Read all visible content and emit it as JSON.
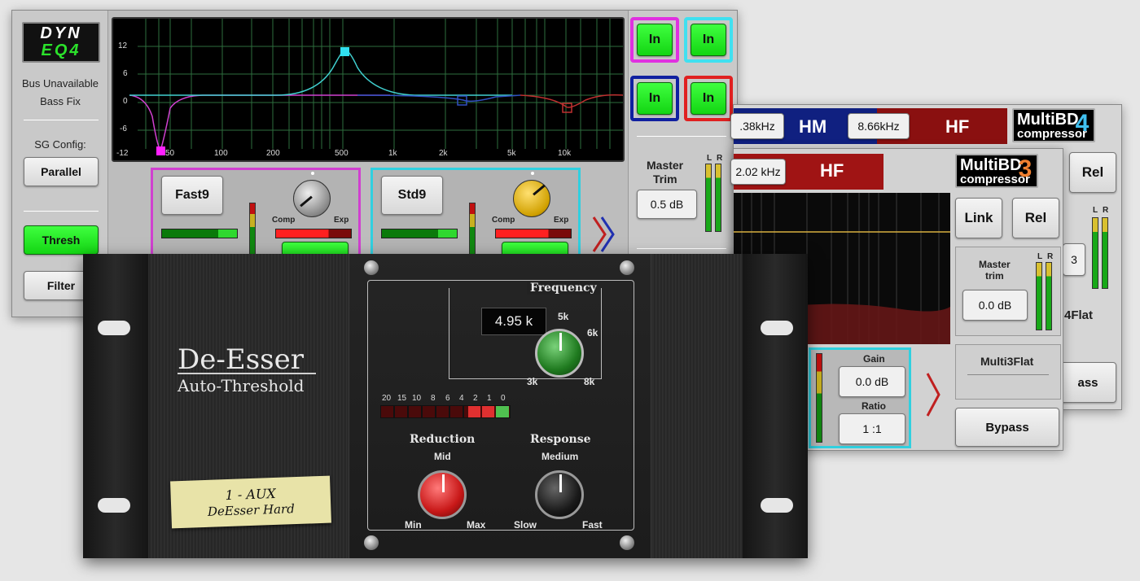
{
  "dyn_eq4": {
    "logo_top": "DYN",
    "logo_bottom": "EQ4",
    "status_line1": "Bus Unavailable",
    "status_line2": "Bass Fix",
    "sg_config_label": "SG Config:",
    "parallel_button": "Parallel",
    "thresh_button": "Thresh",
    "filter_button": "Filter",
    "graph": {
      "y_ticks": [
        "12",
        "6",
        "0",
        "-6",
        "-12"
      ],
      "x_ticks": [
        "50",
        "100",
        "200",
        "500",
        "1k",
        "2k",
        "5k",
        "10k"
      ]
    },
    "band1": {
      "preset": "Fast9",
      "comp_label": "Comp",
      "exp_label": "Exp"
    },
    "band2": {
      "preset": "Std9",
      "comp_label": "Comp",
      "exp_label": "Exp"
    },
    "in_buttons": [
      "In",
      "In",
      "In",
      "In"
    ],
    "master_trim_label_1": "Master",
    "master_trim_label_2": "Trim",
    "master_trim_value": "0.5 dB",
    "meter_l": "L",
    "meter_r": "R"
  },
  "multibd4": {
    "freq1": ".38kHz",
    "band_hm": "HM",
    "freq2": "8.66kHz",
    "band_hf": "HF",
    "logo_line1": "MultiBD",
    "logo_line2": "compressor",
    "logo_num": "4",
    "rel_button": "Rel",
    "value_partial": "3",
    "preset_partial": "4Flat",
    "bypass_partial": "ass",
    "meter_l": "L",
    "meter_r": "R"
  },
  "multibd3": {
    "freq": "2.02 kHz",
    "band_hf": "HF",
    "logo_line1": "MultiBD",
    "logo_line2": "compressor",
    "logo_num": "3",
    "link_button": "Link",
    "rel_button": "Rel",
    "master_trim_label_1": "Master",
    "master_trim_label_2": "trim",
    "master_trim_value": "0.0 dB",
    "gain_label": "Gain",
    "gain_value": "0.0 dB",
    "ratio_label": "Ratio",
    "ratio_value": "1 :1",
    "preset": "Multi3Flat",
    "bypass_button": "Bypass",
    "meter_l": "L",
    "meter_r": "R"
  },
  "deesser": {
    "title": "De-Esser",
    "subtitle": "Auto-Threshold",
    "tape_line1": "1 - AUX",
    "tape_line2": "DeEsser Hard",
    "frequency_label": "Frequency",
    "frequency_value": "4.95 k",
    "freq_marks": [
      "5k",
      "6k",
      "3k",
      "8k"
    ],
    "meter_ticks": [
      "20",
      "15",
      "10",
      "8",
      "6",
      "4",
      "2",
      "1",
      "0"
    ],
    "reduction_label": "Reduction",
    "reduction_mid": "Mid",
    "reduction_min": "Min",
    "reduction_max": "Max",
    "response_label": "Response",
    "response_medium": "Medium",
    "response_slow": "Slow",
    "response_fast": "Fast"
  }
}
